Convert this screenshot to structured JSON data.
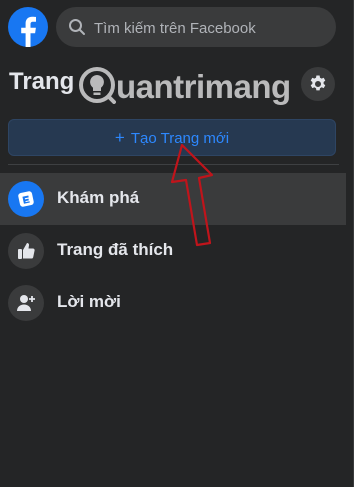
{
  "search": {
    "placeholder": "Tìm kiếm trên Facebook"
  },
  "header": {
    "title": "Trang"
  },
  "watermark": {
    "text": "uantrimang"
  },
  "actions": {
    "create_label": "Tạo Trang mới",
    "create_plus": "+"
  },
  "nav": {
    "items": [
      {
        "label": "Khám phá",
        "icon": "explore-icon"
      },
      {
        "label": "Trang đã thích",
        "icon": "thumbs-up-icon"
      },
      {
        "label": "Lời mời",
        "icon": "add-person-icon"
      }
    ]
  },
  "colors": {
    "accent": "#2d88ff",
    "brand": "#1877f2",
    "annotation_arrow": "#c0141b"
  }
}
